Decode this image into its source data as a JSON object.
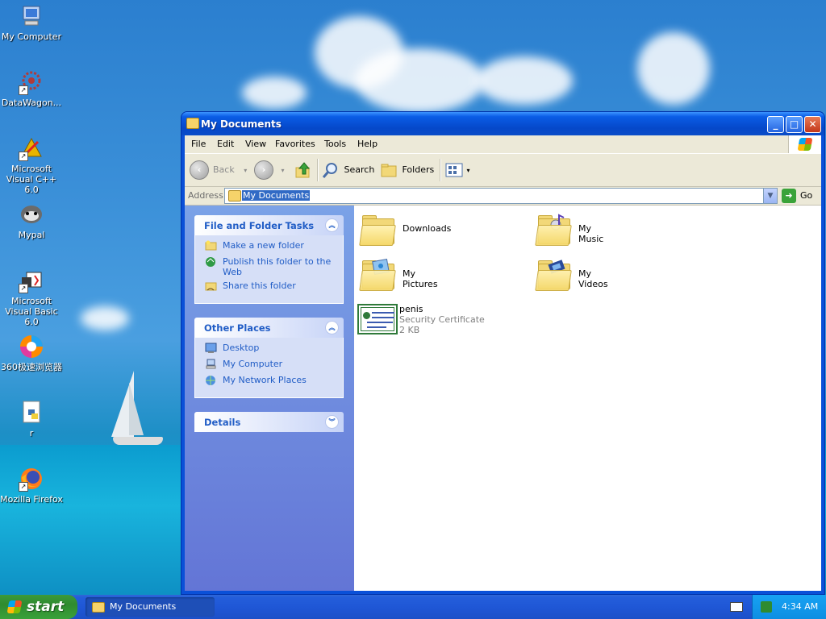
{
  "desktop": {
    "icons": [
      {
        "label": "My Computer",
        "icon": "computer-icon"
      },
      {
        "label": "DataWagon...",
        "icon": "datawagon-icon"
      },
      {
        "label": "Microsoft Visual C++ 6.0",
        "icon": "visual-cpp-icon"
      },
      {
        "label": "Mypal",
        "icon": "mypal-icon"
      },
      {
        "label": "Microsoft Visual Basic 6.0",
        "icon": "visual-basic-icon"
      },
      {
        "label": "360极速浏览器",
        "icon": "browser-360-icon"
      },
      {
        "label": "r",
        "icon": "python-file-icon"
      },
      {
        "label": "Mozilla Firefox",
        "icon": "firefox-icon"
      }
    ]
  },
  "window": {
    "title": "My Documents",
    "menu": [
      "File",
      "Edit",
      "View",
      "Favorites",
      "Tools",
      "Help"
    ],
    "toolbar": {
      "back_label": "Back",
      "search_label": "Search",
      "folders_label": "Folders"
    },
    "address": {
      "label": "Address",
      "value": "My Documents",
      "go_label": "Go"
    },
    "panels": {
      "file_tasks": {
        "title": "File and Folder Tasks",
        "items": [
          {
            "label": "Make a new folder",
            "icon": "new-folder-icon"
          },
          {
            "label": "Publish this folder to the Web",
            "icon": "publish-web-icon"
          },
          {
            "label": "Share this folder",
            "icon": "share-folder-icon"
          }
        ]
      },
      "other_places": {
        "title": "Other Places",
        "items": [
          {
            "label": "Desktop",
            "icon": "desktop-icon"
          },
          {
            "label": "My Computer",
            "icon": "computer-icon"
          },
          {
            "label": "My Network Places",
            "icon": "network-places-icon"
          }
        ]
      },
      "details": {
        "title": "Details"
      }
    },
    "files": [
      {
        "name": "Downloads",
        "icon": "folder-icon"
      },
      {
        "name": "My Music",
        "icon": "music-folder-icon"
      },
      {
        "name": "My Pictures",
        "icon": "pictures-folder-icon"
      },
      {
        "name": "My Videos",
        "icon": "videos-folder-icon"
      },
      {
        "name": "penis",
        "type": "Security Certificate",
        "size": "2 KB",
        "icon": "certificate-icon"
      }
    ]
  },
  "taskbar": {
    "start_label": "start",
    "task_label": "My Documents",
    "clock": "4:34 AM"
  },
  "colors": {
    "title_blue": "#0a5ce6",
    "task_link": "#215dc6",
    "start_green": "#2f8b2f",
    "selection": "#316ac5"
  }
}
